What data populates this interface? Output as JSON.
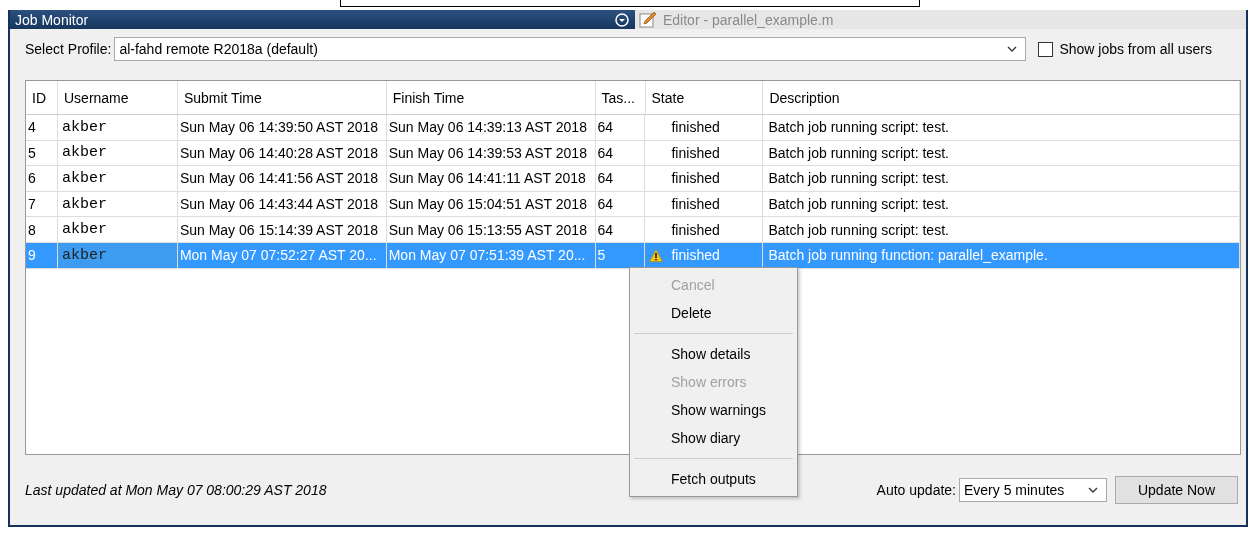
{
  "title_bar": {
    "title": "Job Monitor",
    "tab": "Editor - parallel_example.m"
  },
  "profile": {
    "label": "Select Profile:",
    "value": "al-fahd remote R2018a (default)"
  },
  "show_all_users": {
    "label": "Show jobs from all users",
    "checked": false
  },
  "table": {
    "columns": [
      "ID",
      "Username",
      "Submit Time",
      "Finish Time",
      "Tas...",
      "State",
      "Description"
    ],
    "rows": [
      {
        "id": "4",
        "username": "akber",
        "submit_time": "Sun May 06 14:39:50 AST 2018",
        "finish_time": "Sun May 06 14:39:13 AST 2018",
        "tasks": "64",
        "state": "finished",
        "warning": false,
        "description": "Batch job running script: test.",
        "selected": false
      },
      {
        "id": "5",
        "username": "akber",
        "submit_time": "Sun May 06 14:40:28 AST 2018",
        "finish_time": "Sun May 06 14:39:53 AST 2018",
        "tasks": "64",
        "state": "finished",
        "warning": false,
        "description": "Batch job running script: test.",
        "selected": false
      },
      {
        "id": "6",
        "username": "akber",
        "submit_time": "Sun May 06 14:41:56 AST 2018",
        "finish_time": "Sun May 06 14:41:11 AST 2018",
        "tasks": "64",
        "state": "finished",
        "warning": false,
        "description": "Batch job running script: test.",
        "selected": false
      },
      {
        "id": "7",
        "username": "akber",
        "submit_time": "Sun May 06 14:43:44 AST 2018",
        "finish_time": "Sun May 06 15:04:51 AST 2018",
        "tasks": "64",
        "state": "finished",
        "warning": false,
        "description": "Batch job running script: test.",
        "selected": false
      },
      {
        "id": "8",
        "username": "akber",
        "submit_time": "Sun May 06 15:14:39 AST 2018",
        "finish_time": "Sun May 06 15:13:55 AST 2018",
        "tasks": "64",
        "state": "finished",
        "warning": false,
        "description": "Batch job running script: test.",
        "selected": false
      },
      {
        "id": "9",
        "username": "akber",
        "submit_time": "Mon May 07 07:52:27 AST 20...",
        "finish_time": "Mon May 07 07:51:39 AST 20...",
        "tasks": "5",
        "state": "finished",
        "warning": true,
        "description": "Batch job running function: parallel_example.",
        "selected": true
      }
    ]
  },
  "context_menu": {
    "items": [
      {
        "kind": "item",
        "label": "Cancel",
        "disabled": true
      },
      {
        "kind": "item",
        "label": "Delete",
        "disabled": false
      },
      {
        "kind": "separator"
      },
      {
        "kind": "item",
        "label": "Show details",
        "disabled": false
      },
      {
        "kind": "item",
        "label": "Show errors",
        "disabled": true
      },
      {
        "kind": "item",
        "label": "Show warnings",
        "disabled": false
      },
      {
        "kind": "item",
        "label": "Show diary",
        "disabled": false
      },
      {
        "kind": "separator"
      },
      {
        "kind": "item",
        "label": "Fetch outputs",
        "disabled": false
      }
    ]
  },
  "footer": {
    "last_updated": "Last updated at Mon May 07 08:00:29 AST 2018",
    "auto_update_label": "Auto update:",
    "auto_update_value": "Every 5 minutes",
    "update_button": "Update Now"
  }
}
